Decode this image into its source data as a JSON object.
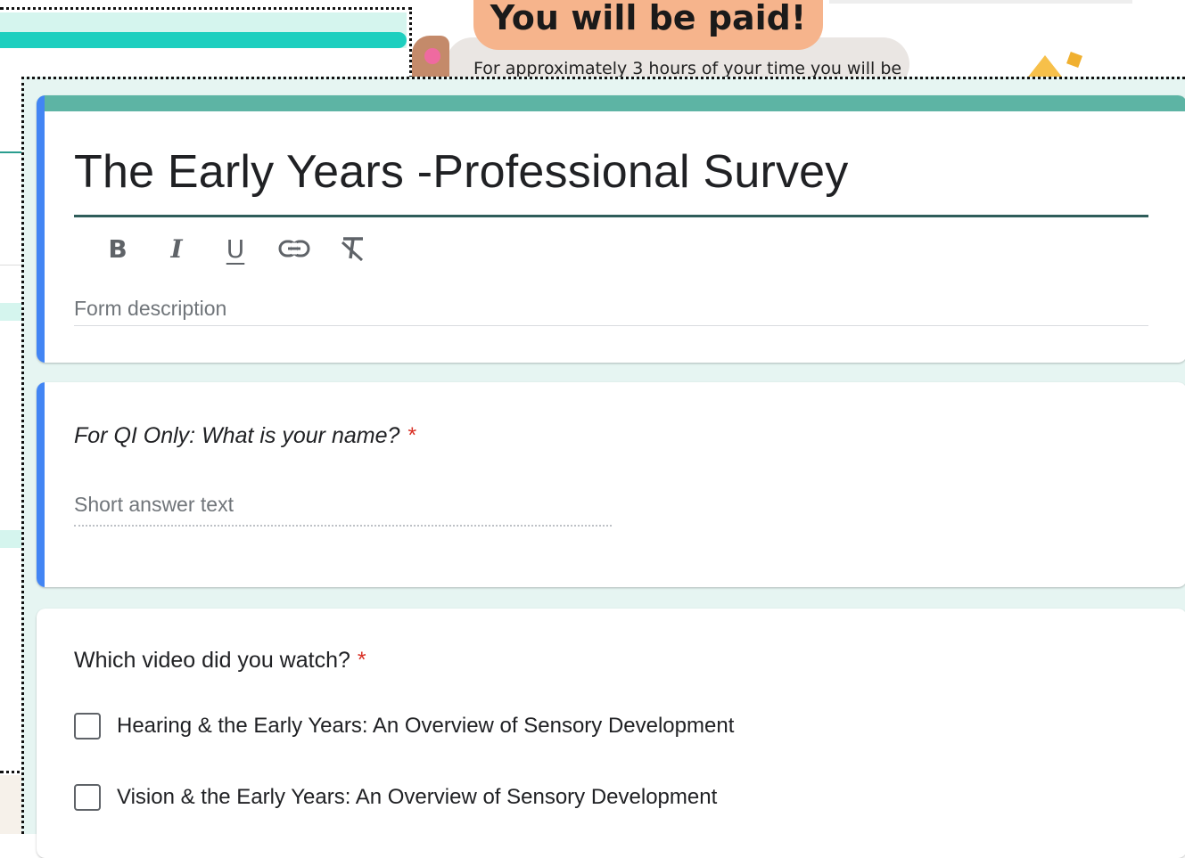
{
  "banner": {
    "headline": "You will be paid!",
    "subtext": "For approximately 3 hours of your time you will be"
  },
  "form": {
    "title": "The Early Years -Professional Survey",
    "toolbar": {
      "bold": "B",
      "italic": "I",
      "underline": "U",
      "link_icon": "link-icon",
      "clear_format_icon": "clear-format-icon"
    },
    "description_placeholder": "Form description",
    "questions": [
      {
        "title": "For QI Only: What is your name?",
        "required_mark": "*",
        "answer_placeholder": "Short answer text"
      },
      {
        "title": "Which video did you watch?",
        "required_mark": "*",
        "options": [
          "Hearing & the Early Years: An Overview of Sensory Development",
          "Vision & the Early Years: An Overview of Sensory Development"
        ]
      }
    ]
  },
  "colors": {
    "header_bar": "#5db4a4",
    "active_accent": "#4285f4",
    "required": "#d93025",
    "form_background": "#e6f5f2",
    "banner_bubble": "#f6b48c"
  }
}
